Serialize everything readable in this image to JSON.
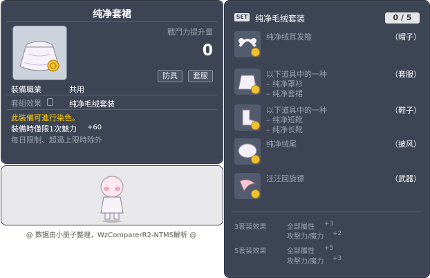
{
  "window_tag": "01054317",
  "item": {
    "name": "纯净套裙",
    "power_label": "戰鬥力提升量",
    "power_value": "0",
    "chips": [
      "防具",
      "套服"
    ],
    "job_label": "裝備職業",
    "job_value": "共用",
    "set_label": "套組效果",
    "set_value": "纯净毛绒套装",
    "dye_note": "此裝備可進行染色。",
    "stat_line": "裝備時僅限1次魅力",
    "stat_bonus": "+60",
    "limit_note": "每日限制、超過上限時除外"
  },
  "footer": "@ 数据由小册子整理，WzComparerR2-NTMS解析 @",
  "set": {
    "badge": "SET",
    "name": "纯净毛绒套装",
    "counter": "0 / 5",
    "items": [
      {
        "name": "纯净绒耳发箍",
        "category": "（帽子）",
        "subs": [],
        "icon": "headband-icon"
      },
      {
        "name": "以下道具中的一种",
        "category": "（套服）",
        "subs": [
          "– 纯净罩衫",
          "– 纯净套裙"
        ],
        "icon": "outfit-icon"
      },
      {
        "name": "以下道具中的一种",
        "category": "（鞋子）",
        "subs": [
          "– 纯净短靴",
          "– 纯净长靴"
        ],
        "icon": "boots-icon"
      },
      {
        "name": "纯净绒尾",
        "category": "（披风）",
        "subs": [],
        "icon": "tail-icon"
      },
      {
        "name": "汪汪回旋镖",
        "category": "（武器）",
        "subs": [],
        "icon": "boomerang-icon"
      }
    ],
    "effects": [
      {
        "label": "3套装效果",
        "lines": [
          {
            "stat": "全部屬性",
            "val": "+3"
          },
          {
            "stat": "攻擊力/魔力",
            "val": "+2"
          }
        ]
      },
      {
        "label": "5套装效果",
        "lines": [
          {
            "stat": "全部屬性",
            "val": "+5"
          },
          {
            "stat": "攻擊力/魔力",
            "val": "+3"
          }
        ]
      }
    ]
  },
  "colors": {
    "panel": "#3d4555",
    "gold": "#ffcc00",
    "muted": "#9aa1ad"
  }
}
